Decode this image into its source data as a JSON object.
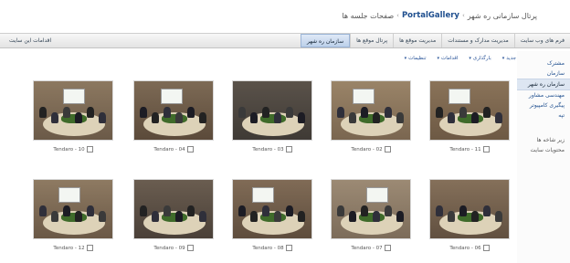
{
  "breadcrumb": {
    "items": [
      "پرتال سازمانی ره شهر",
      "PortalGallery",
      "صفحات جلسه ها"
    ],
    "separator": "›"
  },
  "topnav": {
    "tabs": [
      "سازمان ره شهر",
      "پرتال موقع ها",
      "مدیریت موقع ها",
      "مدیریت مدارک و مستندات",
      "فرم های وب سایت"
    ],
    "site_actions": "اقدامات این سایت"
  },
  "sidebar": {
    "items": [
      "مشترک",
      "سازمان",
      "سازمان ره شهر",
      "مهندسی مشاور",
      "پیگیری کامپیوتر",
      "تپه"
    ],
    "sub_items": [
      "زیر شاخه ها",
      "محتویات سایت"
    ]
  },
  "toolbar": {
    "items": [
      "جدید",
      "بارگذاری",
      "اقدامات",
      "تنظیمات"
    ]
  },
  "gallery": {
    "photos": [
      {
        "caption": "Tendaro - 11"
      },
      {
        "caption": "Tendaro - 02"
      },
      {
        "caption": "Tendaro - 03"
      },
      {
        "caption": "Tendaro - 04"
      },
      {
        "caption": "Tendaro - 10"
      },
      {
        "caption": "Tendaro - 06"
      },
      {
        "caption": "Tendaro - 07"
      },
      {
        "caption": "Tendaro - 08"
      },
      {
        "caption": "Tendaro - 09"
      },
      {
        "caption": "Tendaro - 12"
      }
    ]
  },
  "colors": {
    "link_blue": "#1f4f8f",
    "nav_active": "#bcd0ea",
    "wood_wall": "#6b5a48"
  }
}
